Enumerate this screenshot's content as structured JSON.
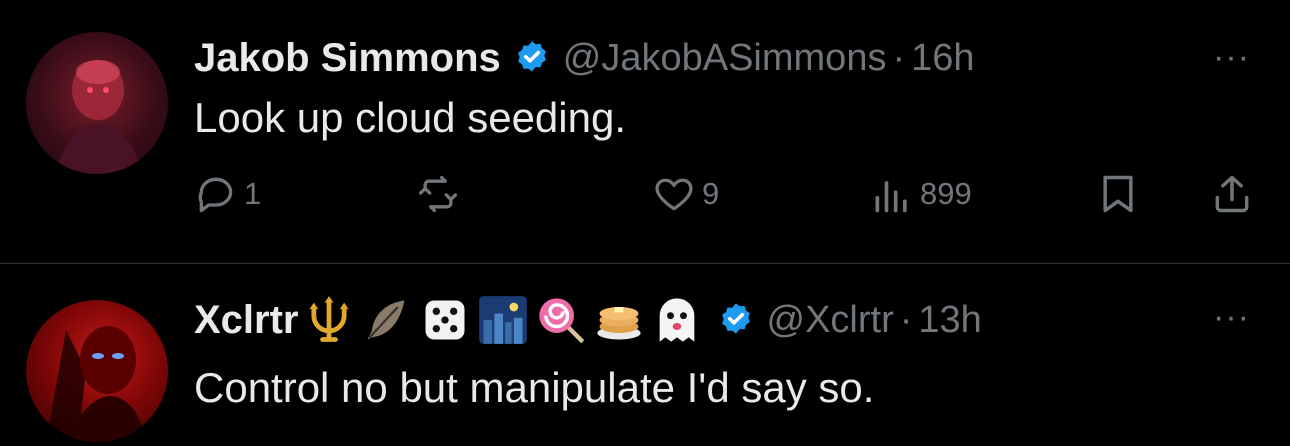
{
  "tweets": [
    {
      "name": "Jakob Simmons",
      "handle": "@JakobASimmons",
      "dot": "·",
      "time": "16h",
      "text": "Look up cloud seeding.",
      "more": "···",
      "actions": {
        "reply_count": "1",
        "retweet_count": "",
        "like_count": "9",
        "view_count": "899"
      }
    },
    {
      "name": "Xclrtr",
      "name_emojis": [
        "trident",
        "feather",
        "game-die",
        "night-city",
        "lollipop",
        "pancakes",
        "ghost"
      ],
      "handle": "@Xclrtr",
      "dot": "·",
      "time": "13h",
      "text": "Control no but manipulate I'd say so.",
      "more": "···"
    }
  ],
  "colors": {
    "background": "#000000",
    "text": "#e7e9ea",
    "secondary": "#71767b",
    "verified": "#1d9bf0",
    "divider": "#2f3336"
  },
  "icons": [
    "reply-icon",
    "retweet-icon",
    "like-icon",
    "views-icon",
    "bookmark-icon",
    "share-icon",
    "verified-badge-icon",
    "more-icon"
  ]
}
